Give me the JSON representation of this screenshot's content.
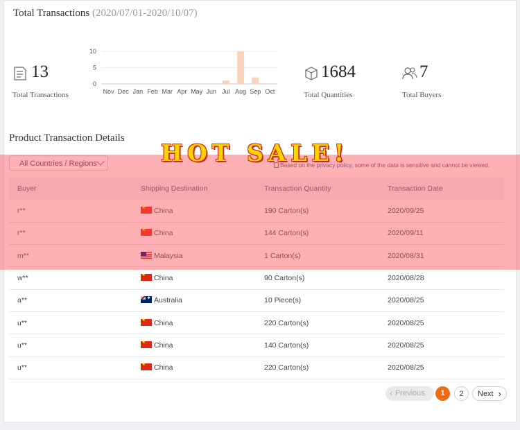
{
  "header": {
    "title": "Total Transactions",
    "date_range": "(2020/07/01-2020/10/07)"
  },
  "stats": [
    {
      "icon": "document-icon",
      "value": "13",
      "label": "Total Transactions"
    },
    {
      "icon": "box-icon",
      "value": "1684",
      "label": "Total Quantities"
    },
    {
      "icon": "users-icon",
      "value": "7",
      "label": "Total Buyers"
    }
  ],
  "chart_data": {
    "type": "bar",
    "categories": [
      "Nov",
      "Dec",
      "Jan",
      "Feb",
      "Mar",
      "Apr",
      "May",
      "Jun",
      "Jul",
      "Aug",
      "Sep",
      "Oct"
    ],
    "values": [
      0,
      0,
      0,
      0,
      0,
      0,
      0,
      0,
      1,
      10,
      2,
      0
    ],
    "yticks": [
      0,
      5,
      10
    ],
    "ylim": [
      0,
      10
    ],
    "title": "",
    "xlabel": "",
    "ylabel": "",
    "bar_color": "#f9d3bd",
    "grid": true
  },
  "details": {
    "title": "Product Transaction Details",
    "filter_label": "All Countries / Regions",
    "notice_prefix": "Based on the ",
    "notice_link": "privacy policy",
    "notice_suffix": ", some of the data is sensitive and cannot be viewed."
  },
  "table": {
    "columns": [
      "Buyer",
      "Shipping Destination",
      "Transaction Quantity",
      "Transaction Date"
    ],
    "rows": [
      {
        "buyer": "r**",
        "flag": "cn",
        "dest": "China",
        "qty": "190 Carton(s)",
        "date": "2020/09/25"
      },
      {
        "buyer": "r**",
        "flag": "cn",
        "dest": "China",
        "qty": "144 Carton(s)",
        "date": "2020/09/11"
      },
      {
        "buyer": "m**",
        "flag": "my",
        "dest": "Malaysia",
        "qty": "1 Carton(s)",
        "date": "2020/08/31"
      },
      {
        "buyer": "w**",
        "flag": "cn",
        "dest": "China",
        "qty": "90 Carton(s)",
        "date": "2020/08/28"
      },
      {
        "buyer": "a**",
        "flag": "au",
        "dest": "Australia",
        "qty": "10 Piece(s)",
        "date": "2020/08/25"
      },
      {
        "buyer": "u**",
        "flag": "cn",
        "dest": "China",
        "qty": "220 Carton(s)",
        "date": "2020/08/25"
      },
      {
        "buyer": "u**",
        "flag": "cn",
        "dest": "China",
        "qty": "140 Carton(s)",
        "date": "2020/08/25"
      },
      {
        "buyer": "u**",
        "flag": "cn",
        "dest": "China",
        "qty": "220 Carton(s)",
        "date": "2020/08/25"
      }
    ]
  },
  "pagination": {
    "prev": "Previous",
    "pages": [
      "1",
      "2"
    ],
    "current": "1",
    "next": "Next"
  },
  "overlay": {
    "text": "HOT SALE!"
  },
  "colors": {
    "accent": "#f26b14",
    "link": "#2a5db0",
    "overlay": "#ff505a"
  }
}
